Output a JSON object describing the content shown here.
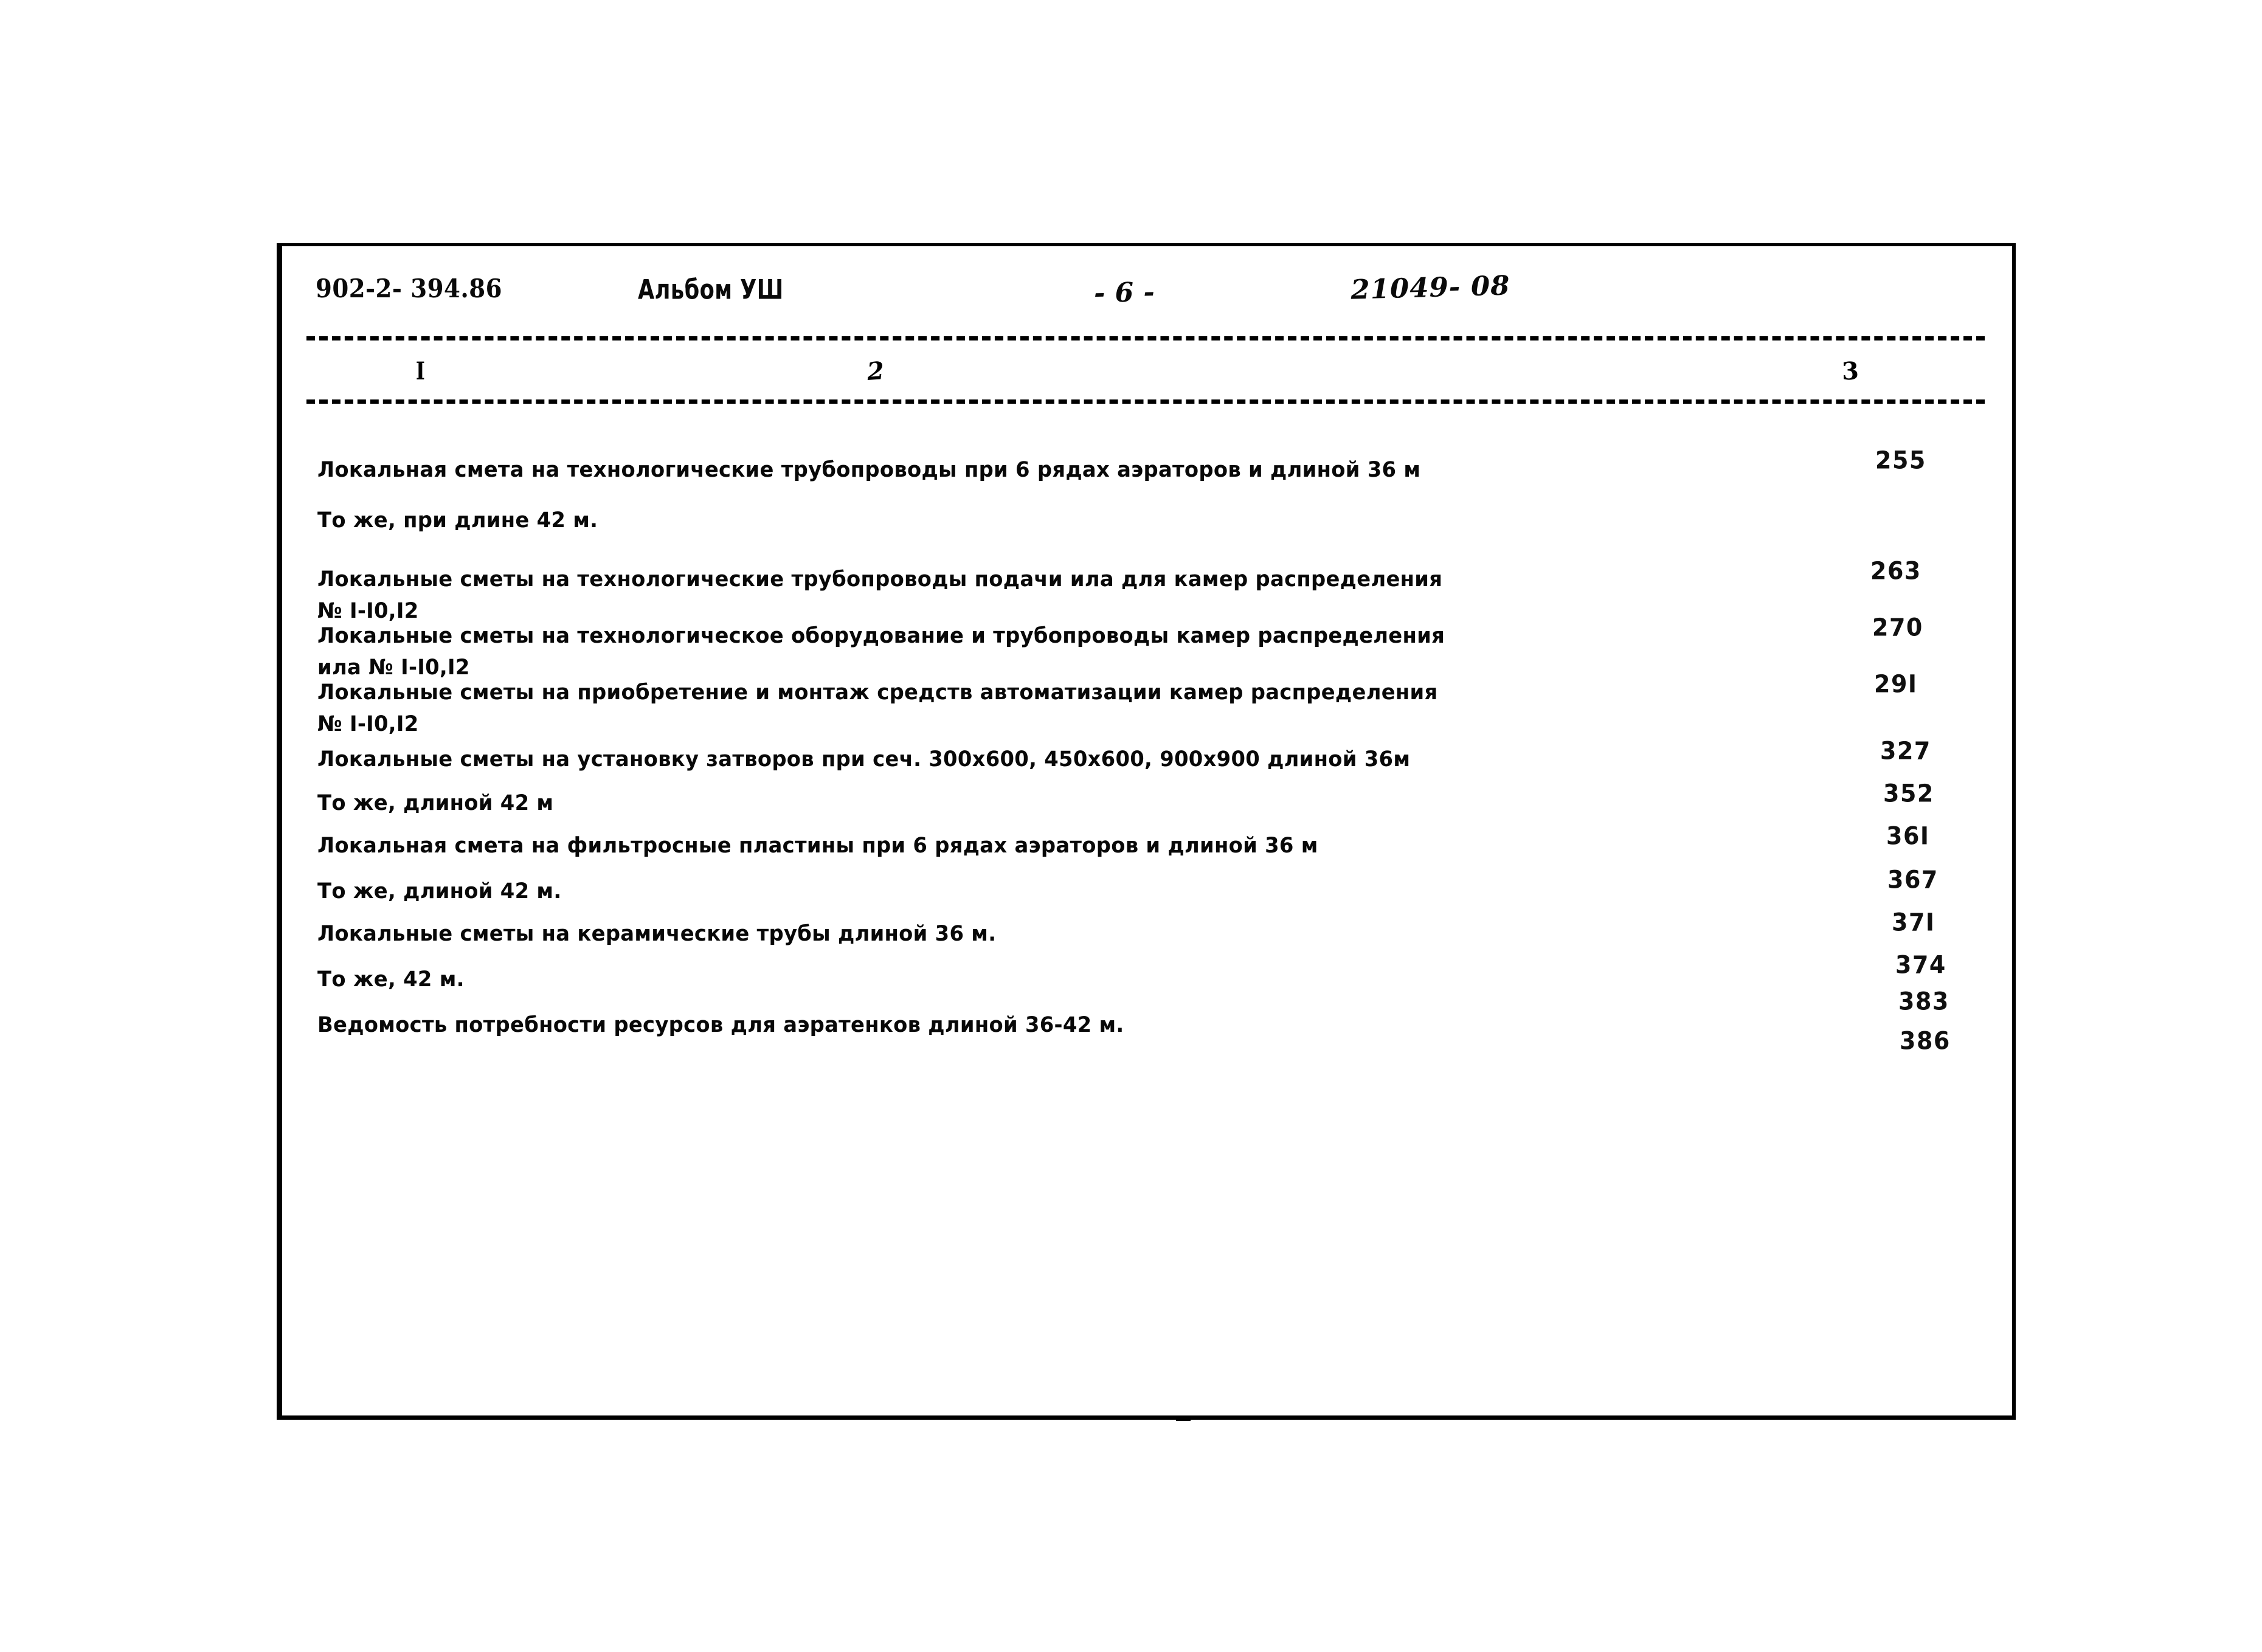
{
  "document": {
    "code": "902-2- 394.86",
    "album": "Альбом УШ",
    "page_marker": "- 6 -",
    "stamp": "21049- 08"
  },
  "table": {
    "column_numbers": {
      "col1": "I",
      "col2": "2",
      "col3": "3"
    },
    "rows": [
      {
        "title": "Локальная смета на технологические трубопроводы при 6 рядах аэраторов и длиной 36 м",
        "page": "255"
      },
      {
        "title": "То же, при длине 42 м.",
        "page": ""
      },
      {
        "title": "Локальные сметы на технологические трубопроводы подачи ила для камер распределения\n№ I-I0,I2",
        "page": "263"
      },
      {
        "title": "Локальные сметы на технологическое оборудование и трубопроводы камер распределения\n  ила № I-I0,I2",
        "page": "270"
      },
      {
        "title": "Локальные сметы на приобретение и монтаж средств автоматизации камер распределения\n№ I-I0,I2",
        "page": "29I"
      },
      {
        "title": "Локальные сметы на установку затворов при сеч. 300х600, 450х600, 900х900 длиной 36м",
        "page": "327"
      },
      {
        "title": "То же, длиной 42 м",
        "page": "352"
      },
      {
        "title": "Локальная смета на фильтросные пластины при 6 рядах аэраторов и длиной 36 м",
        "page": "36I"
      },
      {
        "title": "То же, длиной 42 м.",
        "page": "367"
      },
      {
        "title": "Локальные сметы на керамические трубы длиной 36 м.",
        "page": "37I"
      },
      {
        "title": "То же, 42 м.",
        "page": "374"
      },
      {
        "title": "Ведомость потребности ресурсов для аэратенков длиной 36-42 м.",
        "page": "383"
      },
      {
        "title": "",
        "page": "386"
      }
    ]
  }
}
